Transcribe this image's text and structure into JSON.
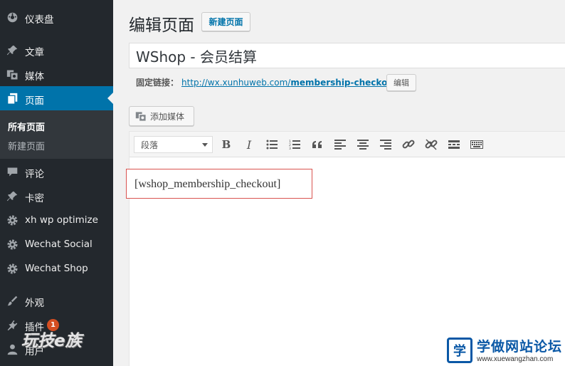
{
  "sidebar": {
    "items": [
      {
        "label": "仪表盘",
        "icon": "dashboard-icon"
      },
      {
        "label": "文章",
        "icon": "pin-icon"
      },
      {
        "label": "媒体",
        "icon": "media-icon"
      },
      {
        "label": "页面",
        "icon": "pages-icon",
        "current": true
      },
      {
        "label": "评论",
        "icon": "comment-icon"
      },
      {
        "label": "卡密",
        "icon": "pin-icon"
      },
      {
        "label": "xh wp optimize",
        "icon": "gear-icon"
      },
      {
        "label": "Wechat Social",
        "icon": "gear-icon"
      },
      {
        "label": "Wechat Shop",
        "icon": "gear-icon"
      },
      {
        "label": "外观",
        "icon": "brush-icon"
      },
      {
        "label": "插件",
        "icon": "plugin-icon",
        "badge": "1"
      },
      {
        "label": "用户",
        "icon": "user-icon"
      }
    ],
    "submenu": [
      {
        "label": "所有页面",
        "active": true
      },
      {
        "label": "新建页面",
        "active": false
      }
    ]
  },
  "header": {
    "title": "编辑页面",
    "new_button": "新建页面"
  },
  "post": {
    "title": "WShop - 会员结算",
    "permalink_label": "固定链接：",
    "permalink_base": "http://wx.xunhuweb.com/",
    "permalink_slug": "membership-checkout",
    "edit_button": "编辑"
  },
  "editor": {
    "add_media": "添加媒体",
    "format_select": "段落",
    "toolbar_icons": [
      "bold-icon",
      "italic-icon",
      "bullet-list-icon",
      "numbered-list-icon",
      "blockquote-icon",
      "align-left-icon",
      "align-center-icon",
      "align-right-icon",
      "link-icon",
      "unlink-icon",
      "read-more-icon",
      "toolbar-toggle-icon"
    ],
    "content": "[wshop_membership_checkout]"
  },
  "watermarks": {
    "left": "玩技e族",
    "right_logo": "学",
    "right_title": "学做网站论坛",
    "right_url": "www.xuewangzhan.com"
  },
  "colors": {
    "sidebar_bg": "#23282d",
    "current_bg": "#0073aa",
    "highlight_border": "#d9534f",
    "badge": "#d54e21"
  }
}
